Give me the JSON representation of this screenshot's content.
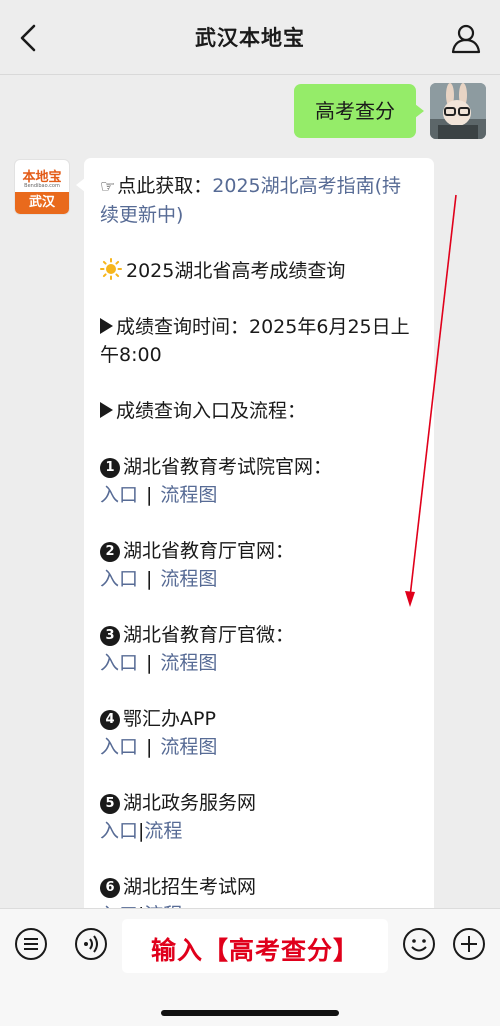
{
  "header": {
    "title": "武汉本地宝",
    "back_icon": "chevron-left-icon",
    "profile_icon": "person-icon"
  },
  "user_message": {
    "text": "高考查分"
  },
  "bot_avatar": {
    "logo_title": "本地宝",
    "logo_sub": "Bendibao.com",
    "city": "武汉"
  },
  "bot_message": {
    "guide_prefix": "点此获取：",
    "guide_link": "2025湖北高考指南(持续更新中)",
    "query_heading": "2025湖北省高考成绩查询",
    "time_line": "成绩查询时间：2025年6月25日上午8:00",
    "entry_heading": "成绩查询入口及流程：",
    "entries": [
      {
        "num": "1",
        "name": "湖北省教育考试院官网：",
        "entry_link": "入口",
        "flow_link": "流程图"
      },
      {
        "num": "2",
        "name": "湖北省教育厅官网：",
        "entry_link": "入口",
        "flow_link": "流程图"
      },
      {
        "num": "3",
        "name": "湖北省教育厅官微：",
        "entry_link": "入口",
        "flow_link": "流程图"
      },
      {
        "num": "4",
        "name": "鄂汇办APP",
        "entry_link": "入口",
        "flow_link": "流程图"
      },
      {
        "num": "5",
        "name": "湖北政务服务网",
        "entry_link": "入口",
        "flow_link": "流程"
      },
      {
        "num": "6",
        "name": "湖北招生考试网",
        "entry_link": "入口",
        "flow_link": "流程"
      }
    ],
    "separator": "|"
  },
  "input_bar": {
    "value": "输入【高考查分】",
    "menu_icon": "menu-list-icon",
    "voice_icon": "voice-icon",
    "emoji_icon": "emoji-icon",
    "add_icon": "add-icon"
  },
  "colors": {
    "link": "#576b95",
    "user_bubble": "#95ec69",
    "annotation_red": "#e0001b"
  }
}
